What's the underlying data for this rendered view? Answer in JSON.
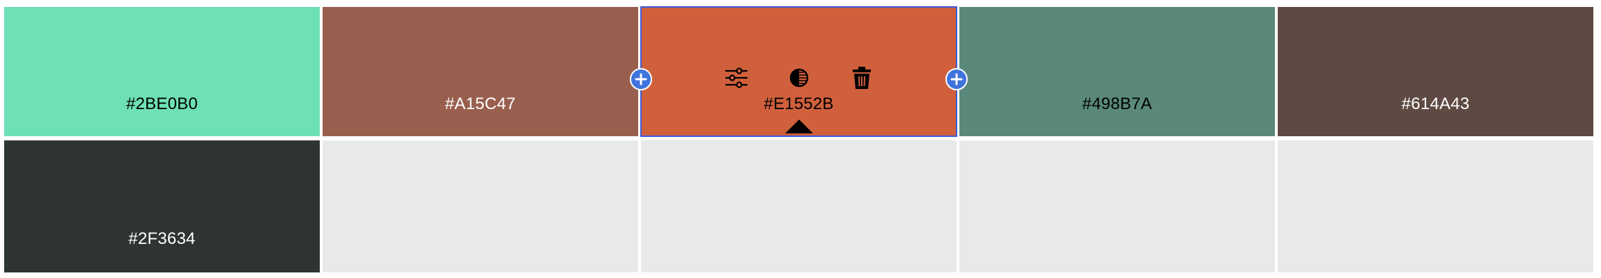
{
  "palette": {
    "rows": [
      [
        {
          "hex": "#2BE0B0",
          "color": "#6de0b5",
          "text_color": "#000000"
        },
        {
          "hex": "#A15C47",
          "color": "#995f4e",
          "text_color": "#ffffff"
        },
        {
          "hex": "#E1552B",
          "color": "#d0603c",
          "text_color": "#000000",
          "selected": true
        },
        {
          "hex": "#498B7A",
          "color": "#5a887a",
          "text_color": "#000000"
        },
        {
          "hex": "#614A43",
          "color": "#5e4a43",
          "text_color": "#ffffff"
        }
      ],
      [
        {
          "hex": "#2F3634",
          "color": "#2e3432",
          "text_color": "#ffffff"
        },
        {
          "hex": "",
          "color": "#e9e9e9",
          "empty": true
        },
        {
          "hex": "",
          "color": "#e9e9e9",
          "empty": true
        },
        {
          "hex": "",
          "color": "#e9e9e9",
          "empty": true
        },
        {
          "hex": "",
          "color": "#e9e9e9",
          "empty": true
        }
      ]
    ],
    "selected_tools": [
      "sliders-icon",
      "contrast-icon",
      "trash-icon"
    ],
    "add_button_icon": "plus-icon",
    "accent": "#3f74dc",
    "selection_outline": "#3b5bd9"
  }
}
